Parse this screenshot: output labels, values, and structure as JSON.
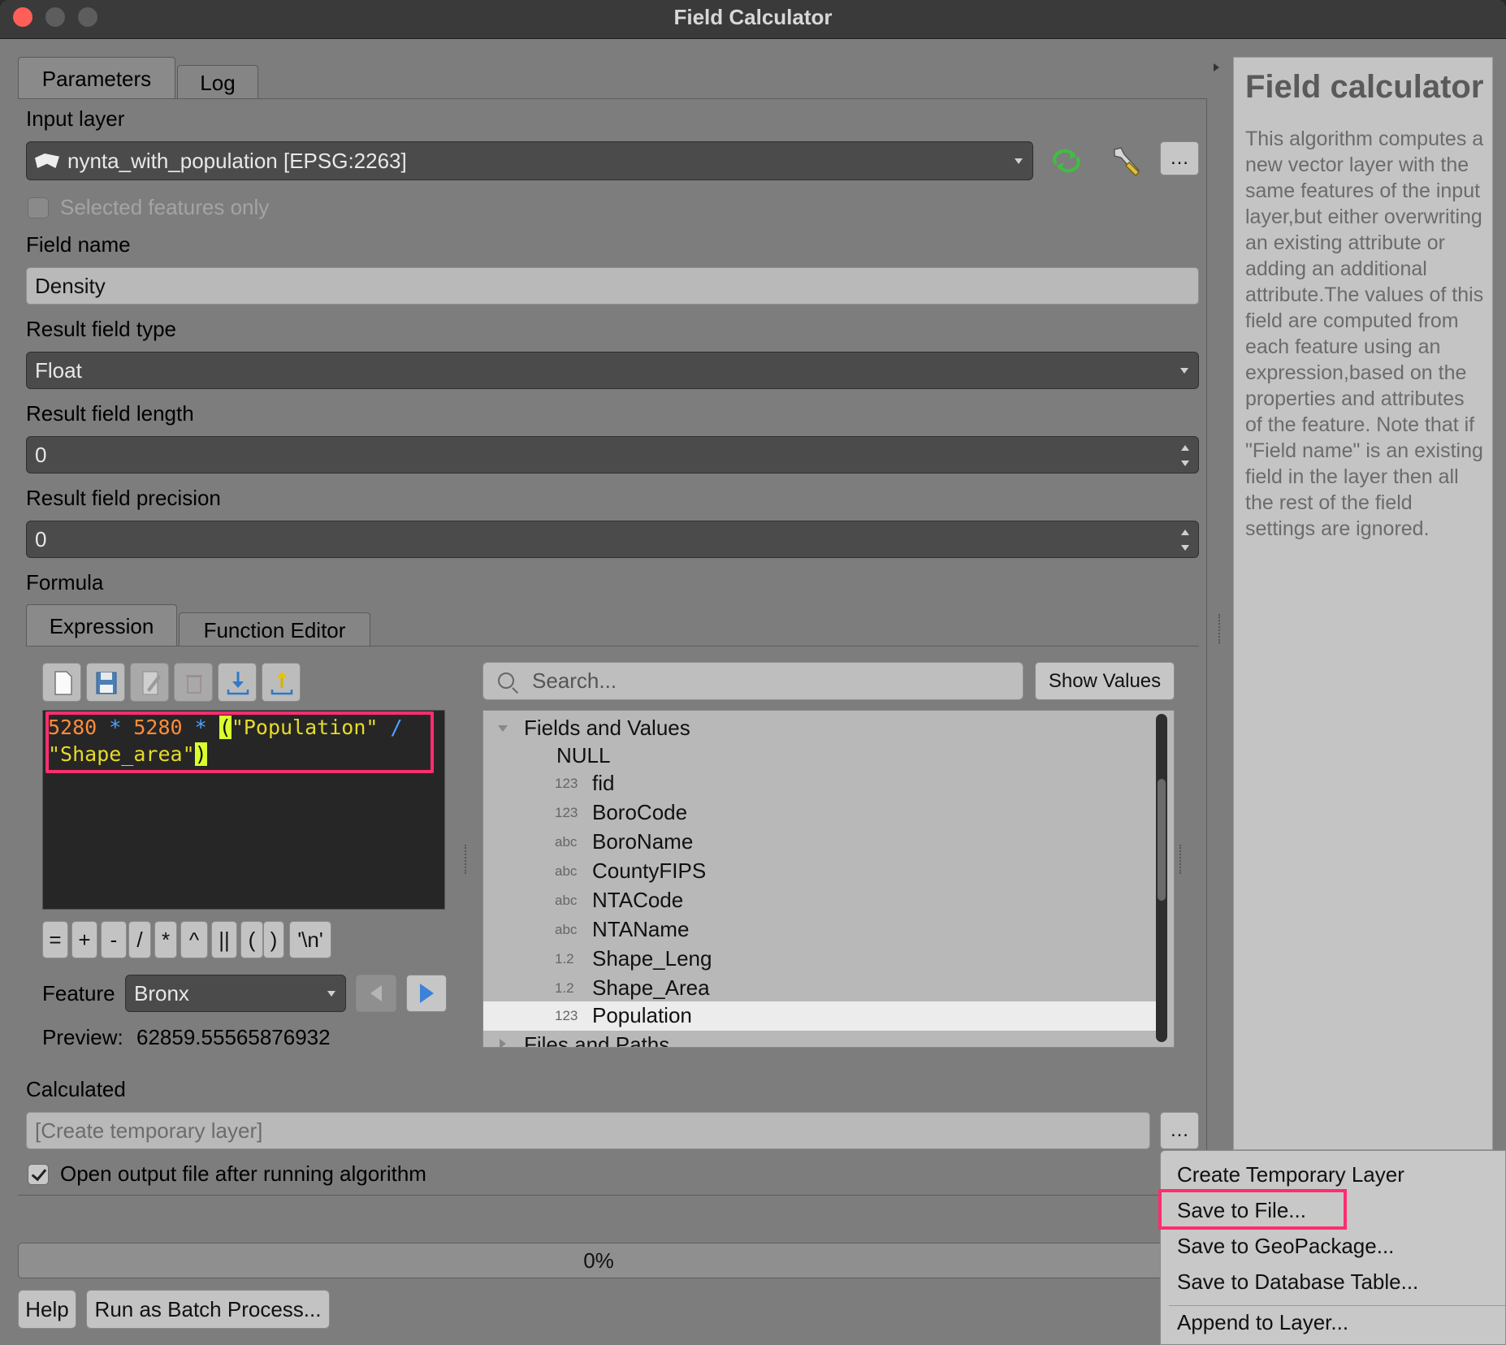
{
  "window": {
    "title": "Field Calculator"
  },
  "tabs": {
    "parameters": "Parameters",
    "log": "Log"
  },
  "input_layer": {
    "label": "Input layer",
    "value": "nynta_with_population [EPSG:2263]",
    "selected_only": "Selected features only",
    "options_button": "…"
  },
  "field_name": {
    "label": "Field name",
    "value": "Density"
  },
  "result_type": {
    "label": "Result field type",
    "value": "Float"
  },
  "result_length": {
    "label": "Result field length",
    "value": "0"
  },
  "result_precision": {
    "label": "Result field precision",
    "value": "0"
  },
  "formula": {
    "label": "Formula",
    "tabs": {
      "expression": "Expression",
      "function_editor": "Function Editor"
    },
    "code": {
      "num1": "5280",
      "op1": " * ",
      "num2": "5280",
      "op2": " * ",
      "open_paren": "(",
      "field1": "\"Population\"",
      "op3": " /",
      "field2": "\"Shape_area\"",
      "close_paren": ")"
    },
    "operators": [
      "=",
      "+",
      "-",
      "/",
      "*",
      "^",
      "||",
      "(",
      ")",
      "'\\n'"
    ],
    "feature_label": "Feature",
    "feature_value": "Bronx",
    "preview_label": "Preview:",
    "preview_value": "62859.55565876932",
    "search_placeholder": "Search...",
    "show_values": "Show Values",
    "tree": {
      "group1": "Fields and Values",
      "null_item": "NULL",
      "fields": [
        {
          "type": "123",
          "name": "fid"
        },
        {
          "type": "123",
          "name": "BoroCode"
        },
        {
          "type": "abc",
          "name": "BoroName"
        },
        {
          "type": "abc",
          "name": "CountyFIPS"
        },
        {
          "type": "abc",
          "name": "NTACode"
        },
        {
          "type": "abc",
          "name": "NTAName"
        },
        {
          "type": "1.2",
          "name": "Shape_Leng"
        },
        {
          "type": "1.2",
          "name": "Shape_Area"
        },
        {
          "type": "123",
          "name": "Population"
        }
      ],
      "group2": "Files and Paths"
    }
  },
  "output": {
    "label": "Calculated",
    "placeholder": "[Create temporary layer]",
    "options_button": "…",
    "open_after": "Open output file after running algorithm"
  },
  "progress": {
    "text": "0%"
  },
  "buttons": {
    "help": "Help",
    "batch": "Run as Batch Process..."
  },
  "help_panel": {
    "title": "Field calculator",
    "body": "This algorithm computes a new vector layer with the same features of the input layer,but either overwriting an existing attribute or adding an additional attribute.The values of this field are computed from each feature using an expression,based on the properties and attributes of the feature. Note that if \"Field name\" is an existing field in the layer then all the rest of the field settings are ignored."
  },
  "output_menu": {
    "items": [
      "Create Temporary Layer",
      "Save to File...",
      "Save to GeoPackage...",
      "Save to Database Table...",
      "Append to Layer..."
    ]
  },
  "colors": {
    "highlight": "#ff2d6f",
    "refresh_icon": "#3fbf3f",
    "bracket_match": "#d9ff2d"
  }
}
